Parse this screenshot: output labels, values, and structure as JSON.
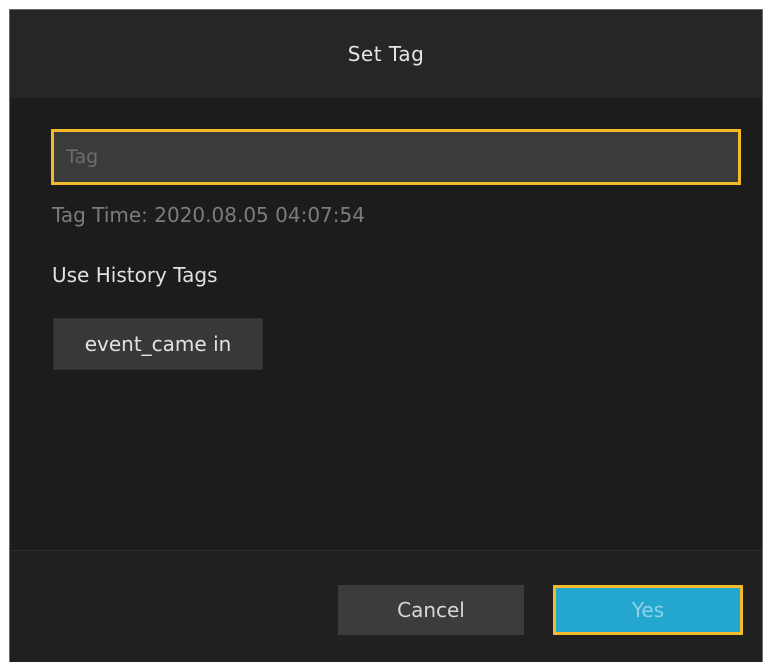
{
  "dialog": {
    "title": "Set Tag",
    "tag_input": {
      "placeholder": "Tag",
      "value": ""
    },
    "tag_time": "Tag Time: 2020.08.05 04:07:54",
    "history_label": "Use History Tags",
    "history_tags": [
      "event_came in"
    ],
    "cancel_label": "Cancel",
    "yes_label": "Yes"
  },
  "colors": {
    "focus_border": "#f3bb2a",
    "primary_button": "#24a7cf",
    "background": "#1e1e1e"
  }
}
